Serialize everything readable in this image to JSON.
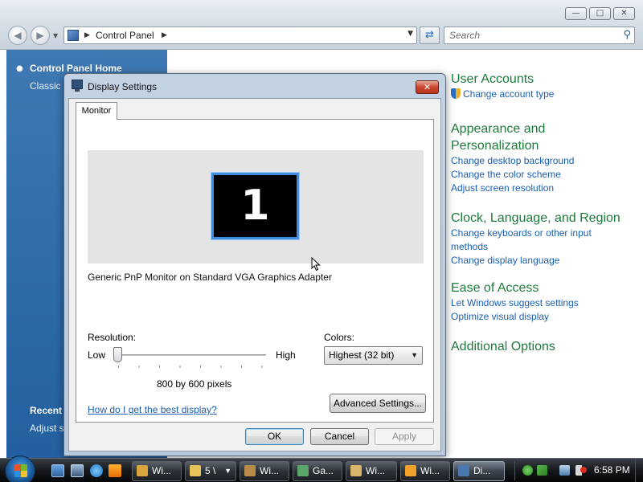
{
  "control_panel": {
    "address": {
      "path": "Control Panel"
    },
    "search": {
      "placeholder": "Search"
    },
    "left_pane": {
      "home": "Control Panel Home",
      "classic": "Classic V",
      "recent_heading": "Recent",
      "recent_item": "Adjust s"
    },
    "categories": [
      {
        "title": "User Accounts",
        "links": [
          "Change account type"
        ]
      },
      {
        "title": "Appearance and Personalization",
        "links": [
          "Change desktop background",
          "Change the color scheme",
          "Adjust screen resolution"
        ]
      },
      {
        "title": "Clock, Language, and Region",
        "links": [
          "Change keyboards or other input methods",
          "Change display language"
        ]
      },
      {
        "title": "Ease of Access",
        "links": [
          "Let Windows suggest settings",
          "Optimize visual display"
        ]
      },
      {
        "title": "Additional Options",
        "links": []
      }
    ]
  },
  "dialog": {
    "title": "Display Settings",
    "tab": "Monitor",
    "monitor_number": "1",
    "adapter": "Generic PnP Monitor on Standard VGA Graphics Adapter",
    "resolution": {
      "label": "Resolution:",
      "low": "Low",
      "high": "High",
      "value": "800 by 600 pixels",
      "slider_position": 0
    },
    "colors": {
      "label": "Colors:",
      "value": "Highest (32 bit)"
    },
    "help_link": "How do I get the best display?",
    "buttons": {
      "advanced": "Advanced Settings...",
      "ok": "OK",
      "cancel": "Cancel",
      "apply": "Apply"
    }
  },
  "taskbar": {
    "tasks": [
      {
        "label": "Wi...",
        "icon": "control-panel-icon",
        "color": "#d9a53c"
      },
      {
        "label": "5 \\",
        "icon": "folder-icon",
        "color": "#e6c35a"
      },
      {
        "label": "Wi...",
        "icon": "film-icon",
        "color": "#b98a4a"
      },
      {
        "label": "Ga...",
        "icon": "games-icon",
        "color": "#5aa66a"
      },
      {
        "label": "Wi...",
        "icon": "contacts-icon",
        "color": "#d9b46a"
      },
      {
        "label": "Wi...",
        "icon": "media-player-icon",
        "color": "#f2a12a"
      },
      {
        "label": "Di...",
        "icon": "display-icon",
        "color": "#4a78b0"
      }
    ],
    "clock": "6:58 PM"
  }
}
